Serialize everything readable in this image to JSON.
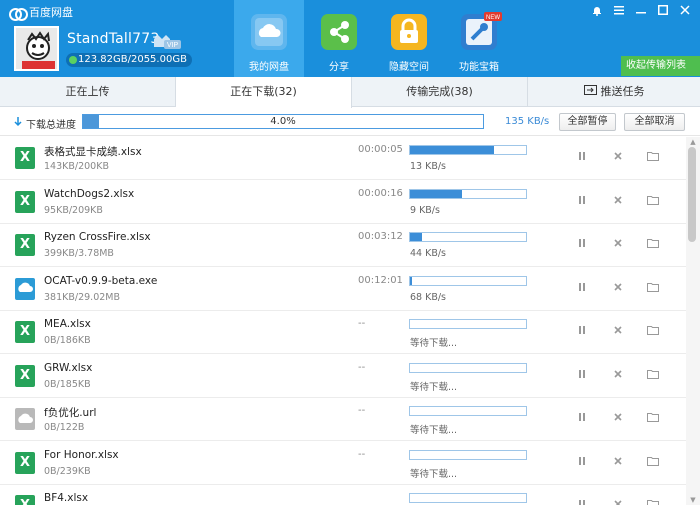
{
  "app": {
    "title": "百度网盘",
    "username": "StandTall773",
    "vip": "VIP",
    "storage": "123.82GB/2055.00GB"
  },
  "nav": [
    {
      "label": "我的网盘",
      "icon": "cloud-icon",
      "color": "#5fb6ee"
    },
    {
      "label": "分享",
      "icon": "share-icon",
      "color": "#5bbf4a"
    },
    {
      "label": "隐藏空间",
      "icon": "lock-icon",
      "color": "#f5b620"
    },
    {
      "label": "功能宝箱",
      "icon": "toolbox-icon",
      "color": "#2f7ecf",
      "badge": "NEW"
    }
  ],
  "window_controls": [
    "bell-icon",
    "menu-icon",
    "minimize-icon",
    "maximize-icon",
    "close-icon"
  ],
  "collapse_button": "收起传输列表",
  "tabs": [
    {
      "label": "正在上传"
    },
    {
      "label": "正在下载(32)"
    },
    {
      "label": "传输完成(38)"
    },
    {
      "label": "推送任务"
    }
  ],
  "total": {
    "label": "下载总进度",
    "percent": 4.0,
    "percent_text": "4.0%",
    "speed": "135 KB/s",
    "pause_all": "全部暂停",
    "cancel_all": "全部取消"
  },
  "files": [
    {
      "name": "表格式显卡成绩.xlsx",
      "size": "143KB/200KB",
      "time": "00:00:05",
      "progress": 0.72,
      "speed": "13 KB/s",
      "type": "xlsx"
    },
    {
      "name": "WatchDogs2.xlsx",
      "size": "95KB/209KB",
      "time": "00:00:16",
      "progress": 0.45,
      "speed": "9 KB/s",
      "type": "xlsx"
    },
    {
      "name": "Ryzen CrossFire.xlsx",
      "size": "399KB/3.78MB",
      "time": "00:03:12",
      "progress": 0.1,
      "speed": "44 KB/s",
      "type": "xlsx"
    },
    {
      "name": "OCAT-v0.9.9-beta.exe",
      "size": "381KB/29.02MB",
      "time": "00:12:01",
      "progress": 0.013,
      "speed": "68 KB/s",
      "type": "exe"
    },
    {
      "name": "MEA.xlsx",
      "size": "0B/186KB",
      "time": "--",
      "progress": 0,
      "speed": "等待下载...",
      "type": "xlsx"
    },
    {
      "name": "GRW.xlsx",
      "size": "0B/185KB",
      "time": "--",
      "progress": 0,
      "speed": "等待下载...",
      "type": "xlsx"
    },
    {
      "name": "f负优化.url",
      "size": "0B/122B",
      "time": "--",
      "progress": 0,
      "speed": "等待下载...",
      "type": "url"
    },
    {
      "name": "For Honor.xlsx",
      "size": "0B/239KB",
      "time": "--",
      "progress": 0,
      "speed": "等待下载...",
      "type": "xlsx"
    },
    {
      "name": "BF4.xlsx",
      "size": "",
      "time": "",
      "progress": 0,
      "speed": "",
      "type": "xlsx"
    }
  ]
}
